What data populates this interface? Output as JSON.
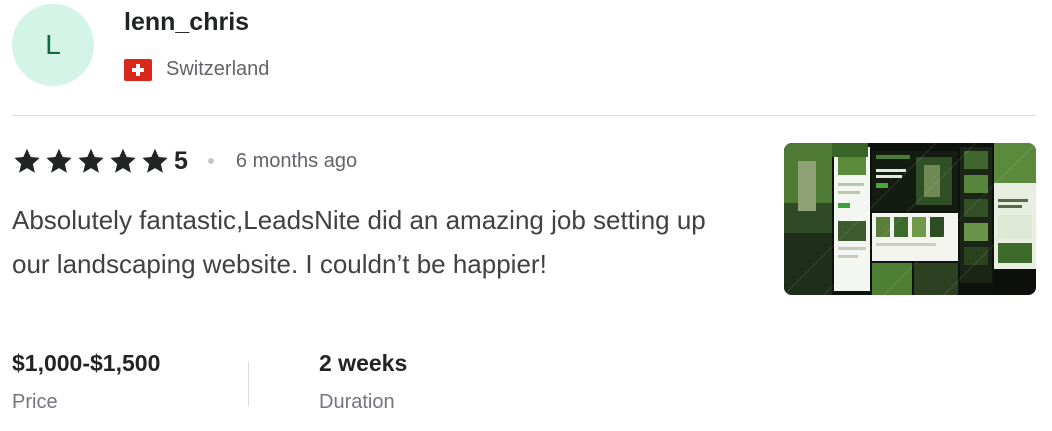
{
  "reviewer": {
    "avatar_initial": "L",
    "username": "lenn_chris",
    "country": "Switzerland",
    "flag_icon": "switzerland-flag-icon"
  },
  "review": {
    "stars": 5,
    "rating": "5",
    "time_ago": "6 months ago",
    "text": "Absolutely fantastic,LeadsNite did an amazing job setting up our landscaping website. I couldn’t be happier!"
  },
  "stats": {
    "price_value": "$1,000-$1,500",
    "price_label": "Price",
    "duration_value": "2 weeks",
    "duration_label": "Duration"
  },
  "colors": {
    "star": "#222325",
    "avatar_bg": "#d4f4e7",
    "flag_red": "#da291c"
  }
}
